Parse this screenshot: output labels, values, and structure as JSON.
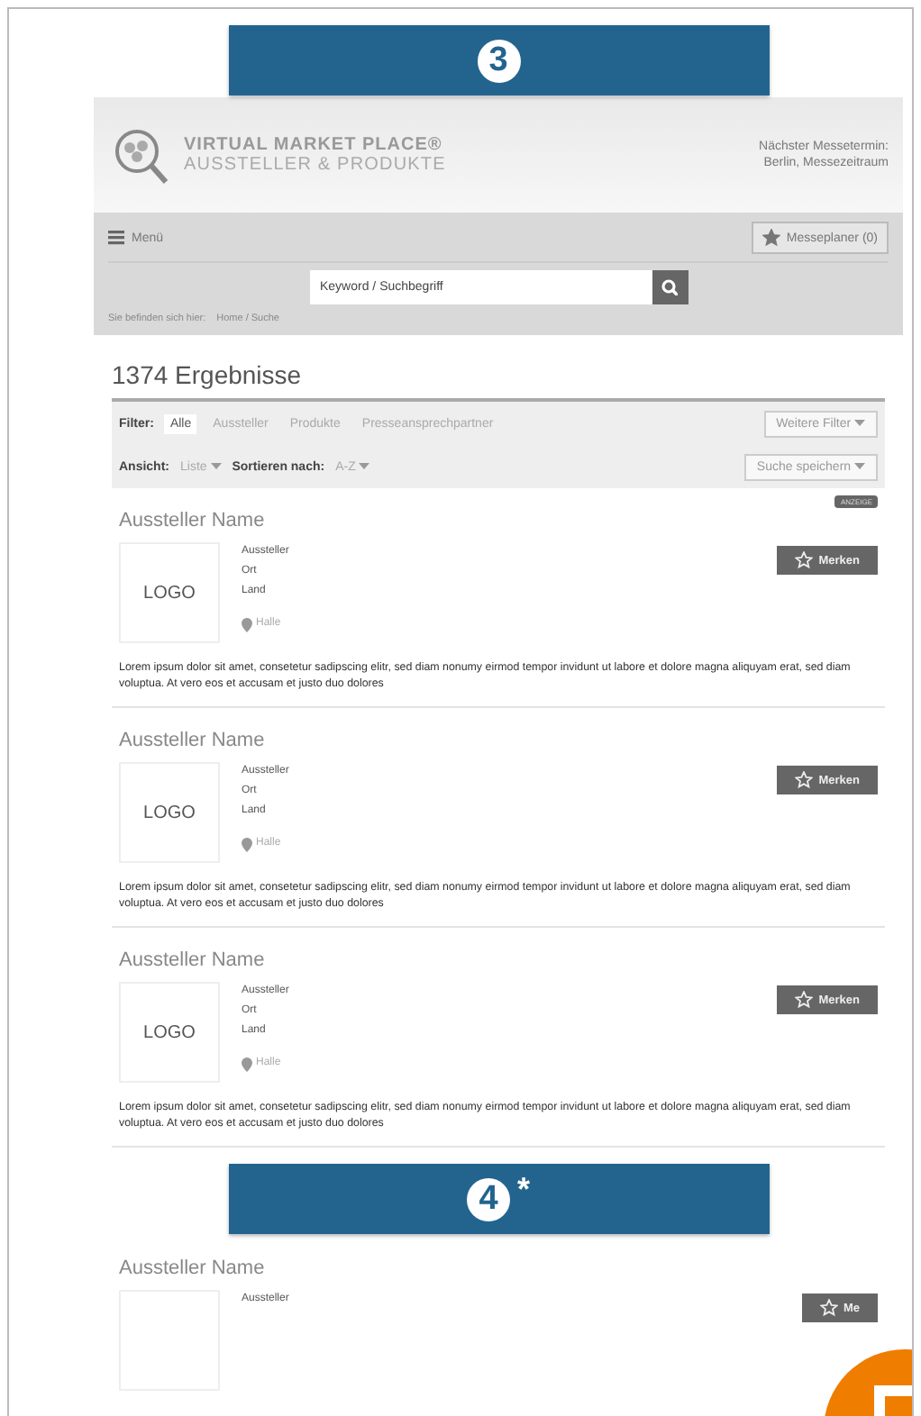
{
  "top_banner": {
    "number": "3"
  },
  "header": {
    "title": "VIRTUAL MARKET PLACE®",
    "subtitle": "AUSSTELLER & PRODUKTE",
    "event_label": "Nächster Messetermin:",
    "event_value": "Berlin, Messezeitraum"
  },
  "nav": {
    "menu": "Menü",
    "planner": "Messeplaner (0)"
  },
  "search": {
    "placeholder": "Keyword / Suchbegriff"
  },
  "breadcrumb": {
    "label": "Sie befinden sich hier:",
    "path": "Home / Suche"
  },
  "results": {
    "title": "1374 Ergebnisse"
  },
  "filters": {
    "label": "Filter:",
    "tabs": [
      {
        "label": "Alle",
        "selected": true
      },
      {
        "label": "Aussteller",
        "selected": false
      },
      {
        "label": "Produkte",
        "selected": false
      },
      {
        "label": "Presseansprechpartner",
        "selected": false
      }
    ],
    "more": "Weitere Filter"
  },
  "view": {
    "label": "Ansicht:",
    "value": "Liste",
    "sort_label": "Sortieren nach:",
    "sort_value": "A-Z",
    "save": "Suche speichern"
  },
  "items": [
    {
      "kind": "exhibitor",
      "badge": "ANZEIGE",
      "name": "Aussteller Name",
      "logo": "LOGO",
      "lines": [
        "Aussteller",
        "Ort",
        "Land"
      ],
      "hall": "Halle",
      "button": "Merken",
      "text": "Lorem ipsum dolor sit amet, consetetur sadipscing elitr, sed diam nonumy eirmod tempor invidunt ut labore et dolore magna aliquyam erat, sed diam voluptua. At vero eos et accusam et justo duo dolores"
    },
    {
      "kind": "exhibitor",
      "name": "Aussteller Name",
      "logo": "LOGO",
      "lines": [
        "Aussteller",
        "Ort",
        "Land"
      ],
      "hall": "Halle",
      "button": "Merken",
      "text": "Lorem ipsum dolor sit amet, consetetur sadipscing elitr, sed diam nonumy eirmod tempor invidunt ut labore et dolore magna aliquyam erat, sed diam voluptua. At vero eos et accusam et justo duo dolores"
    },
    {
      "kind": "exhibitor",
      "name": "Aussteller Name",
      "logo": "LOGO",
      "lines": [
        "Aussteller",
        "Ort",
        "Land"
      ],
      "hall": "Halle",
      "button": "Merken",
      "text": "Lorem ipsum dolor sit amet, consetetur sadipscing elitr, sed diam nonumy eirmod tempor invidunt ut labore et dolore magna aliquyam erat, sed diam voluptua. At vero eos et accusam et justo duo dolores"
    },
    {
      "kind": "banner",
      "number": "4",
      "note": "*"
    },
    {
      "kind": "exhibitor",
      "name": "Aussteller Name",
      "lines": [
        "Aussteller"
      ],
      "button": "Me"
    }
  ]
}
